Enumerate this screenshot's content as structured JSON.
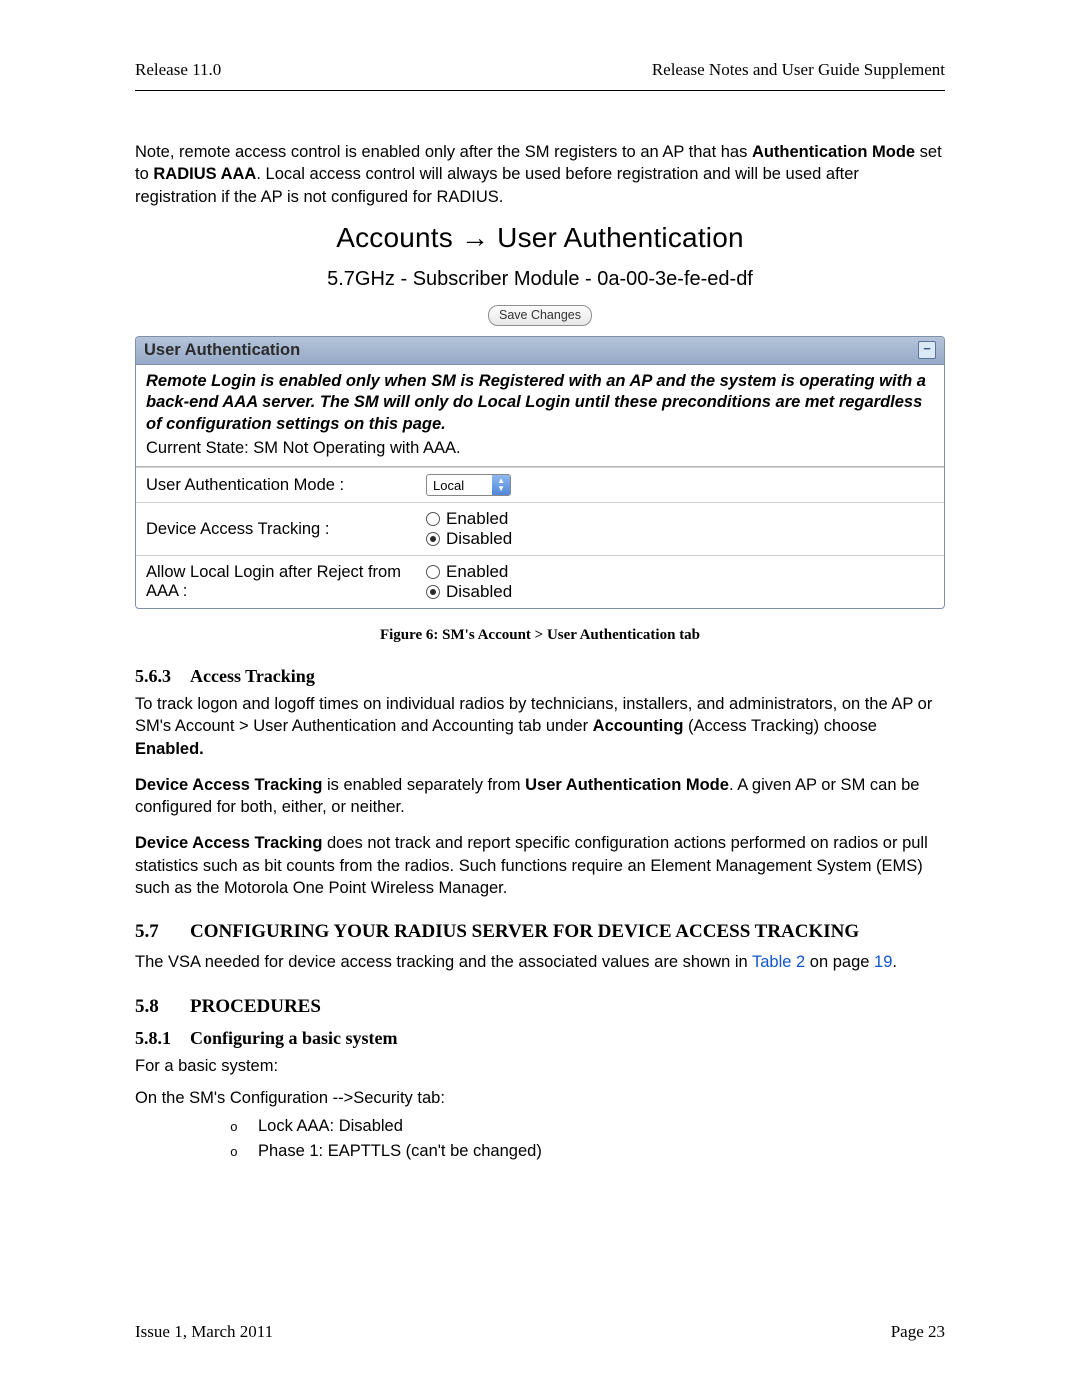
{
  "header": {
    "left": "Release 11.0",
    "right": "Release Notes and User Guide Supplement"
  },
  "intro": {
    "p1a": "Note, remote access control is enabled only after the SM registers to an AP that has ",
    "p1b": "Authentication Mode",
    "p1c": " set to ",
    "p1d": "RADIUS AAA",
    "p1e": ". Local access control will always be used before registration and will be used after registration if the AP is not configured for RADIUS."
  },
  "fig": {
    "title": "Accounts → User Authentication",
    "sub": "5.7GHz - Subscriber Module - 0a-00-3e-fe-ed-df",
    "save": "Save Changes",
    "panel_title": "User Authentication",
    "note": "Remote Login is enabled only when SM is Registered with an AP and the system is operating with a back-end AAA server. The SM will only do Local Login until these preconditions are met regardless of configuration settings on this page.",
    "state": "Current State: SM Not Operating with AAA.",
    "row1_label": "User Authentication Mode :",
    "row1_value": "Local",
    "row2_label": "Device Access Tracking :",
    "row3_label": "Allow Local Login after Reject from AAA :",
    "opt_enabled": "Enabled",
    "opt_disabled": "Disabled",
    "caption": "Figure 6: SM's Account > User Authentication tab"
  },
  "s563": {
    "num": "5.6.3",
    "title": "Access Tracking",
    "p1a": "To track logon and logoff times on individual radios by technicians, installers, and administrators, on the AP or SM's Account > User Authentication and Accounting tab under ",
    "p1b": "Accounting",
    "p1c": " (Access Tracking) choose ",
    "p1d": "Enabled.",
    "p2a": "Device Access Tracking",
    "p2b": " is enabled separately from ",
    "p2c": "User Authentication Mode",
    "p2d": ". A given AP or SM can be configured for both, either, or neither.",
    "p3a": "Device Access Tracking",
    "p3b": " does not track and report specific configuration actions performed on radios or pull statistics such as bit counts from the radios. Such functions require an Element Management System (EMS) such as the Motorola One Point Wireless Manager."
  },
  "s57": {
    "num": "5.7",
    "title": "CONFIGURING YOUR RADIUS SERVER FOR DEVICE ACCESS TRACKING",
    "p1a": "The VSA needed for device access tracking and the associated values are shown in ",
    "p1link": "Table 2",
    "p1b": " on page ",
    "p1link2": "19",
    "p1c": "."
  },
  "s58": {
    "num": "5.8",
    "title": "PROCEDURES"
  },
  "s581": {
    "num": "5.8.1",
    "title": "Configuring a basic system",
    "p1": "For a basic system:",
    "p2": "On the SM's Configuration -->Security tab:",
    "b1": "Lock AAA: Disabled",
    "b2": "Phase 1: EAPTTLS (can't be changed)"
  },
  "footer": {
    "left": "Issue 1, March 2011",
    "right": "Page 23"
  }
}
